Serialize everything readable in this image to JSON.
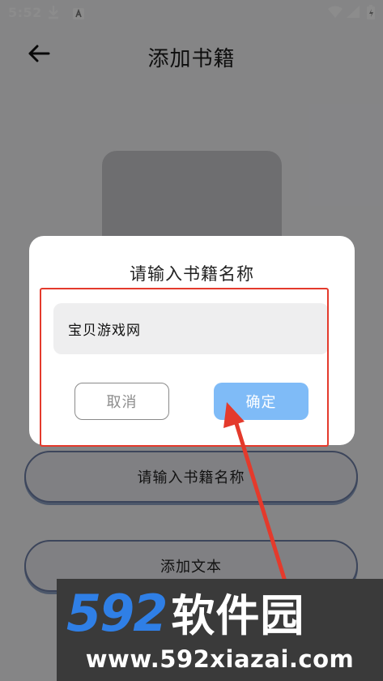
{
  "status_bar": {
    "time": "5:52",
    "icons": [
      "download-icon",
      "a-icon",
      "wifi-icon",
      "signal-icon",
      "battery-icon"
    ]
  },
  "header": {
    "back_icon": "arrow-left-icon",
    "title": "添加书籍"
  },
  "form": {
    "name_button_label": "请输入书籍名称",
    "add_text_button_label": "添加文本"
  },
  "dialog": {
    "title": "请输入书籍名称",
    "input_value": "宝贝游戏网",
    "cancel_label": "取消",
    "confirm_label": "确定"
  },
  "annotation": {
    "color": "#e43a2c"
  },
  "watermark": {
    "digits": "592",
    "name": "软件园",
    "url": "www.592xiazai.com"
  },
  "colors": {
    "accent": "#7fbbf7",
    "watermark_blue": "#2f7fe6"
  }
}
